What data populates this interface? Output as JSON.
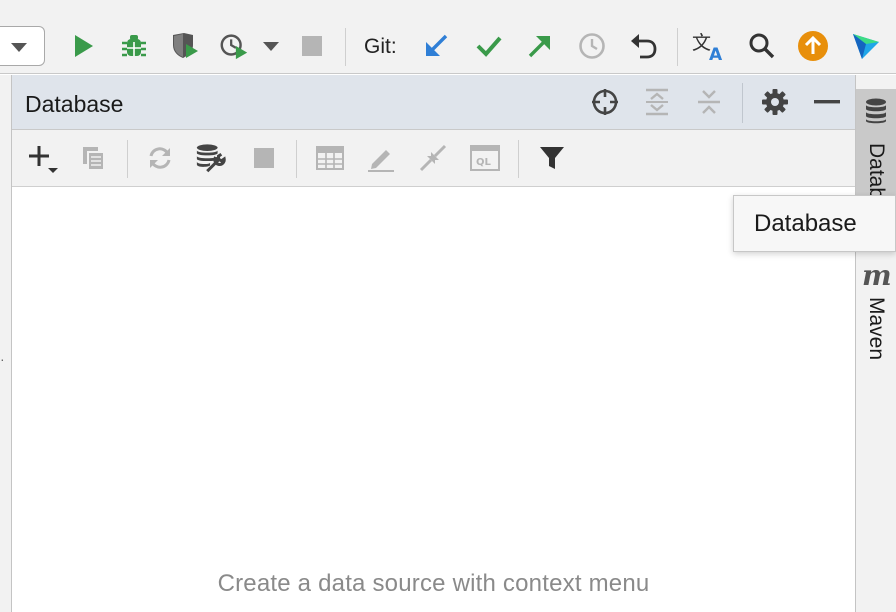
{
  "toolbar": {
    "git_label": "Git:",
    "icons": [
      "run-icon",
      "debug-icon",
      "run-with-coverage-icon",
      "profile-icon",
      "more-run-options-icon",
      "stop-icon",
      "git-update-icon",
      "git-commit-icon",
      "git-push-icon",
      "history-icon",
      "rollback-icon",
      "translate-icon",
      "search-icon",
      "update-available-icon",
      "toolbox-icon"
    ]
  },
  "panel": {
    "title": "Database",
    "header_icons": [
      "locate-icon",
      "expand-all-icon",
      "collapse-all-icon",
      "settings-icon",
      "hide-icon"
    ],
    "toolbar_icons": [
      "add-icon",
      "duplicate-icon",
      "refresh-icon",
      "data-source-properties-icon",
      "stop-icon",
      "table-view-icon",
      "edit-icon",
      "jump-icon",
      "query-console-icon",
      "filter-icon"
    ],
    "empty_text": "Create a data source with context menu"
  },
  "right_strip": {
    "database_tab_label": "Database",
    "maven_tab_icon_text": "m",
    "maven_tab_label": "Maven"
  },
  "tooltip": {
    "text": "Database"
  },
  "colors": {
    "green": "#3a9a4a",
    "blue": "#2f7fd6",
    "orange": "#e88f0b",
    "gray_icon": "#6e6e6e",
    "disabled_icon": "#b5b5b5",
    "header_bg": "#dfe4eb"
  }
}
